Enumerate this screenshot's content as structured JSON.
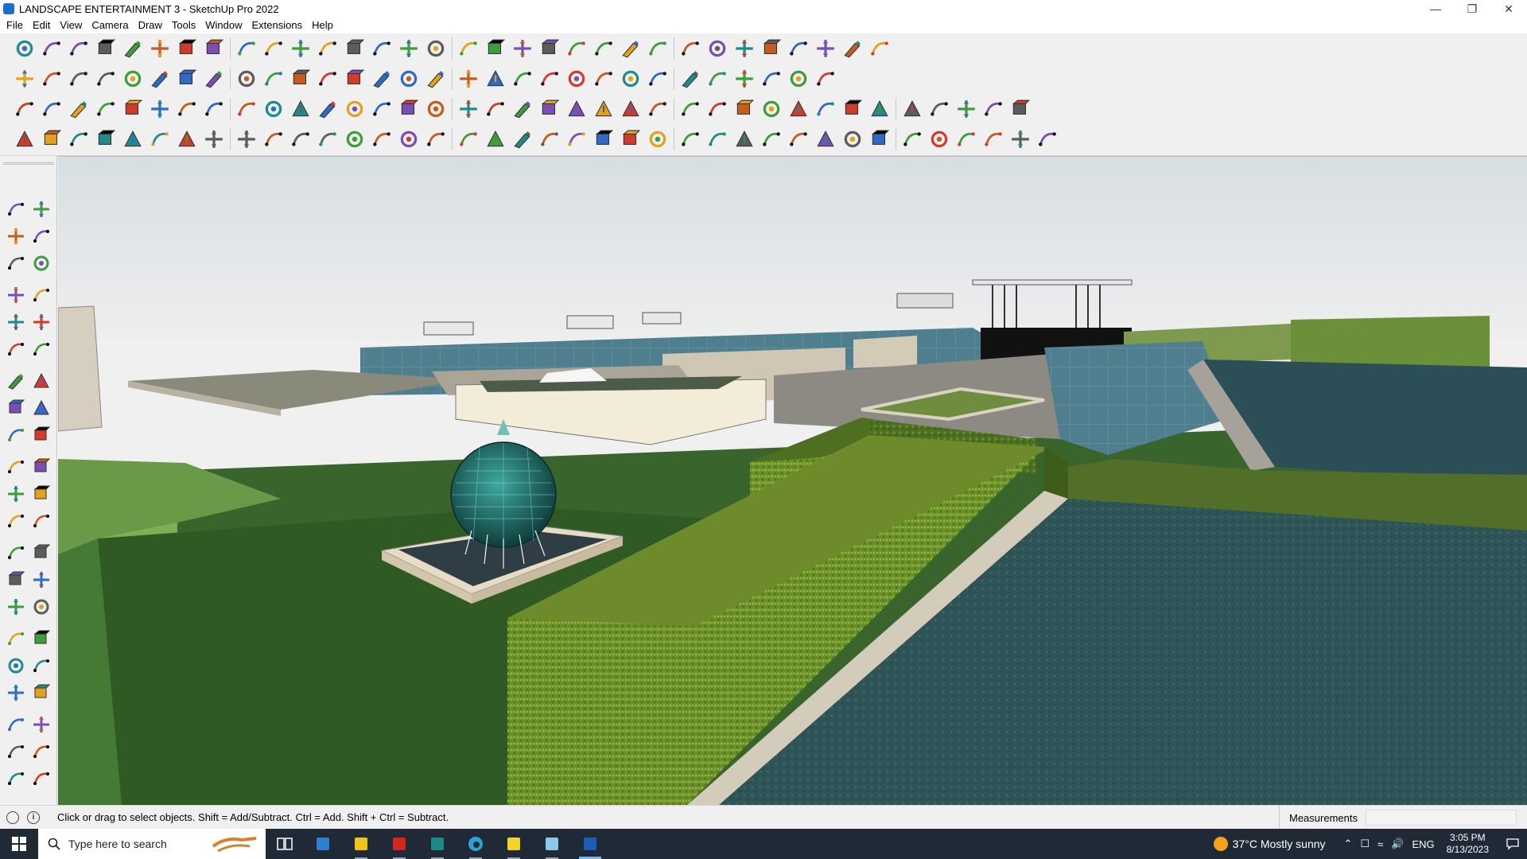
{
  "window": {
    "title": "LANDSCAPE ENTERTAINMENT 3 - SketchUp Pro 2022",
    "minimize_glyph": "—",
    "restore_glyph": "❐",
    "close_glyph": "✕"
  },
  "menu": [
    "File",
    "Edit",
    "View",
    "Camera",
    "Draw",
    "Tools",
    "Window",
    "Extensions",
    "Help"
  ],
  "toolbars": {
    "row1": [
      "zoom-extents",
      "select",
      "eraser",
      "pencil",
      "arc",
      "paint",
      "push-pull",
      "follow-me",
      "move",
      "rotate",
      "scale",
      "tape-measure",
      "text",
      "paint-bucket",
      "orbit",
      "pan",
      "zoom",
      "zoom-window",
      "section-plane",
      "axes",
      "layers",
      "styles",
      "user",
      "model-info",
      "components",
      "materials",
      "sandbox",
      "pipe",
      "solid-tools",
      "undo",
      "redo",
      "warehouse"
    ],
    "row2": [
      "box",
      "cylinder",
      "sphere",
      "extrude",
      "push",
      "solar",
      "arrow",
      "roof",
      "cube",
      "wall",
      "door",
      "window",
      "house",
      "stair",
      "fence",
      "gate",
      "leaf",
      "pen",
      "polygon",
      "circle",
      "hexagon",
      "ellipse",
      "parallelogram",
      "spiral",
      "curve",
      "lasso",
      "cut",
      "explode",
      "tag",
      "rubber"
    ],
    "row3": [
      "blue-box",
      "blue-diamond",
      "yellow-diamond",
      "green-diamond",
      "red-diamond",
      "flat",
      "rotate-yellow",
      "red-square",
      "grid",
      "page",
      "beam",
      "chain",
      "cone",
      "spline",
      "cross-red",
      "cross-green",
      "cross-blue",
      "pyramid",
      "pyramid2",
      "warning",
      "loop",
      "lock",
      "knot",
      "sparkle",
      "bucket",
      "red-loop",
      "tree",
      "split",
      "merge",
      "shuffle",
      "pattern",
      "window-blue",
      "orange-grid",
      "orange-grid2",
      "dots",
      "arc-dashed",
      "tiles"
    ],
    "row4": [
      "pen-line",
      "curve-red",
      "solid-red",
      "scissors",
      "gear",
      "sheet",
      "pipe-curve",
      "mesh",
      "sphere-mesh",
      "funnel",
      "corner",
      "corner2",
      "dash",
      "ribbon",
      "tube",
      "cone-line",
      "stairs-grey",
      "rail",
      "hand",
      "leaf-grey",
      "plane",
      "slices",
      "blade",
      "fan",
      "blade2",
      "fan2",
      "vase",
      "stairs",
      "column",
      "cage",
      "grid-dark",
      "louver",
      "fence-dark",
      "shell",
      "shell2",
      "stripes",
      "striped-fan",
      "origami"
    ]
  },
  "left_tools": [
    "select",
    "orbit",
    "paint",
    "eraser",
    "component",
    "tape",
    "line",
    "freehand",
    "rectangle",
    "rotated-rect",
    "circle",
    "polygon",
    "arc",
    "arc2",
    "pie",
    "shape",
    "move",
    "push-pull",
    "rotate",
    "follow-me",
    "scale",
    "offset",
    "tape-measure",
    "dimension",
    "protractor",
    "text",
    "axes",
    "3d-text",
    "orbit",
    "pan",
    "zoom",
    "zoom-window",
    "zoom-extents",
    "previous",
    "position-camera",
    "look-around",
    "walk",
    "section-plane",
    "layer-a",
    "layer-b",
    "layer-c",
    "layer-d"
  ],
  "status": {
    "hint": "Click or drag to select objects. Shift = Add/Subtract. Ctrl = Add. Shift + Ctrl = Subtract.",
    "measurements_label": "Measurements",
    "info_icon": "i"
  },
  "taskbar": {
    "search_placeholder": "Type here to search",
    "apps": [
      "task-view",
      "calculator",
      "file-explorer",
      "acrobat",
      "sway",
      "edge",
      "sticky-notes",
      "notepad",
      "sketchup"
    ],
    "weather": "37°C  Mostly sunny",
    "language": "ENG",
    "time": "3:05 PM",
    "date": "8/13/2023"
  },
  "colors": {
    "accent": "#1a6ec9",
    "grass": "#3b6b2d",
    "sky": "#dfe6e8",
    "water": "#5d8a98",
    "taskbar": "#1f2a36"
  }
}
